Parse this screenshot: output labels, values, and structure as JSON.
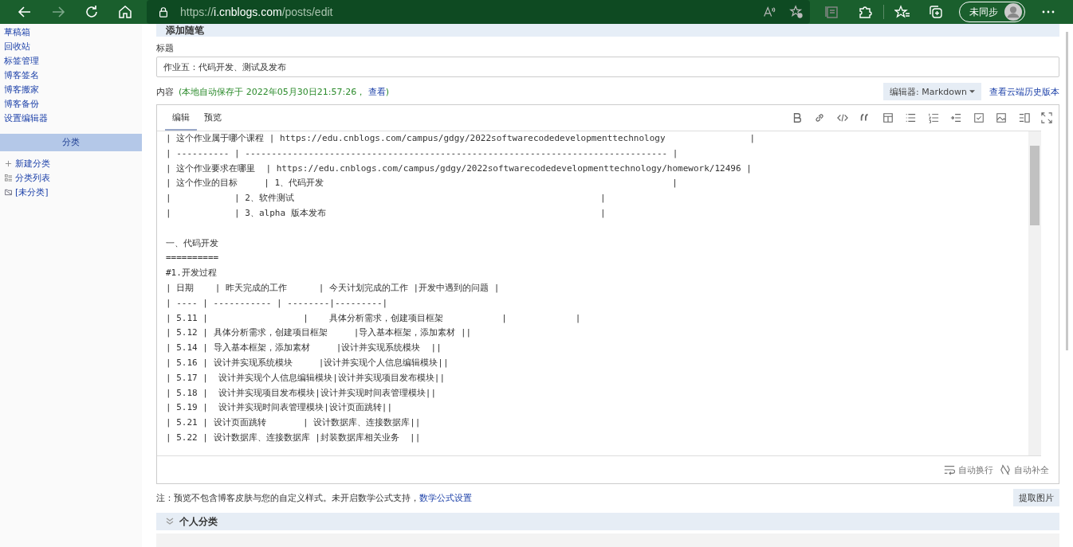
{
  "browser": {
    "url_scheme": "https://",
    "url_host": "i.cnblogs.com",
    "url_path": "/posts/edit",
    "profile_label": "未同步"
  },
  "sidebar": {
    "items": [
      "草稿箱",
      "回收站",
      "标签管理",
      "博客签名",
      "博客搬家",
      "博客备份",
      "设置编辑器"
    ],
    "section_title": "分类",
    "category_actions": [
      {
        "kind": "add",
        "label": "新建分类"
      },
      {
        "kind": "list",
        "label": "分类列表"
      },
      {
        "kind": "folder",
        "label": "[未分类]"
      }
    ]
  },
  "page_header": "添加随笔",
  "title_label": "标题",
  "title_value": "作业五：代码开发、测试及发布",
  "content_label": "内容",
  "autosave": {
    "text": "(本地自动保存于 2022年05月30日21:57:26，",
    "link": "查看",
    "close": ")"
  },
  "editor_selector": "编辑器: Markdown",
  "history_link": "查看云端历史版本",
  "editor": {
    "tabs": [
      {
        "label": "编辑",
        "selected": true
      },
      {
        "label": "预览",
        "selected": false
      }
    ],
    "lines": [
      {
        "kind": "text",
        "text": "| 这个作业属于哪个课程 | https://edu.cnblogs.com/campus/gdgy/2022softwarecodedevelopmenttechnology                |"
      },
      {
        "kind": "text",
        "text": "| ---------- | -------------------------------------------------------------------------------- |"
      },
      {
        "kind": "text",
        "text": "| 这个作业要求在哪里  | https://edu.cnblogs.com/campus/gdgy/2022softwarecodedevelopmenttechnology/homework/12496 |"
      },
      {
        "kind": "text",
        "text": "| 这个作业的目标     | 1、代码开发                                                                  |"
      },
      {
        "kind": "text",
        "text": "|            | 2、软件测试                                                          |"
      },
      {
        "kind": "text",
        "text": "|            | 3、alpha 版本发布                                                    |"
      },
      {
        "kind": "blank"
      },
      {
        "kind": "text",
        "text": "一、代码开发"
      },
      {
        "kind": "text",
        "text": "=========="
      },
      {
        "kind": "text",
        "text": "#1.开发过程"
      },
      {
        "kind": "text",
        "text": "| 日期    | 昨天完成的工作      | 今天计划完成的工作 |开发中遇到的问题 |"
      },
      {
        "kind": "text",
        "text": "| ---- | ----------- | --------|---------|"
      },
      {
        "kind": "text",
        "text": "| 5.11 |                  |    具体分析需求，创建项目框架           |             |"
      },
      {
        "kind": "text",
        "text": "| 5.12 | 具体分析需求，创建项目框架     |导入基本框架，添加素材 ||"
      },
      {
        "kind": "text",
        "text": "| 5.14 | 导入基本框架，添加素材     |设计并实现系统模块  ||"
      },
      {
        "kind": "text",
        "text": "| 5.16 | 设计并实现系统模块     |设计并实现个人信息编辑模块||"
      },
      {
        "kind": "text",
        "text": "| 5.17 |  设计并实现个人信息编辑模块|设计并实现项目发布模块||"
      },
      {
        "kind": "text",
        "text": "| 5.18 |  设计并实现项目发布模块|设计并实现时间表管理模块||"
      },
      {
        "kind": "text",
        "text": "| 5.19 |  设计并实现时间表管理模块|设计页面跳转||"
      },
      {
        "kind": "text",
        "text": "| 5.21 | 设计页面跳转       | 设计数据库、连接数据库||"
      },
      {
        "kind": "text",
        "text": "| 5.22 | 设计数据库、连接数据库 |封装数据库相关业务  ||"
      }
    ],
    "footer": [
      "自动换行",
      "自动补全"
    ]
  },
  "note": {
    "text": "注：预览不包含博客皮肤与您的自定义样式。未开启数学公式支持，",
    "link": "数学公式设置"
  },
  "extract_button": "提取图片",
  "category_panel": {
    "title": "个人分类"
  }
}
